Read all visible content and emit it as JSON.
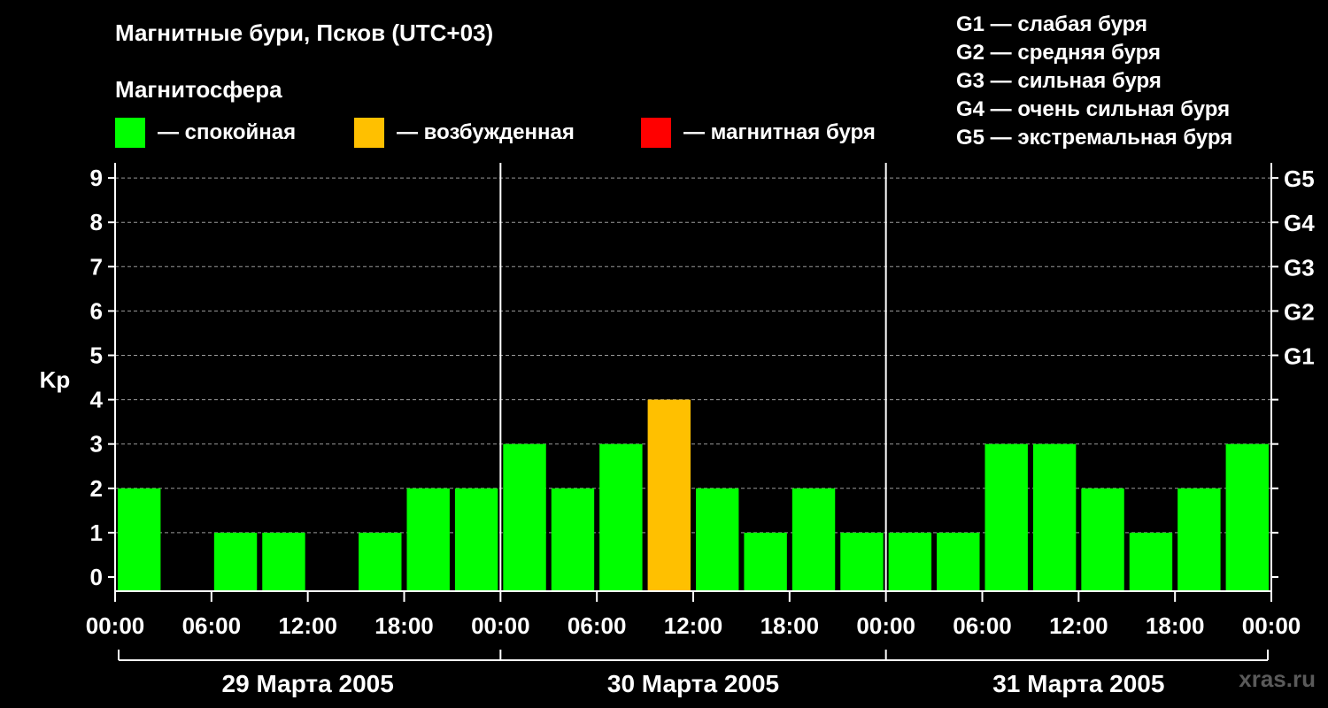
{
  "header": {
    "title": "Магнитные бури, Псков (UTC+03)",
    "subtitle": "Магнитосфера"
  },
  "legend": [
    {
      "label": "— спокойная",
      "color": "#00ff00"
    },
    {
      "label": "— возбужденная",
      "color": "#ffc000"
    },
    {
      "label": "— магнитная буря",
      "color": "#ff0000"
    }
  ],
  "gscale": [
    "G1 — слабая буря",
    "G2 — средняя буря",
    "G3 — сильная буря",
    "G4 — очень сильная буря",
    "G5 — экстремальная буря"
  ],
  "watermark": "xras.ru",
  "chart_data": {
    "type": "bar",
    "title": "Магнитные бури, Псков (UTC+03)",
    "ylabel": "Kp",
    "ylim": [
      0,
      9
    ],
    "yticks": [
      0,
      1,
      2,
      3,
      4,
      5,
      6,
      7,
      8,
      9
    ],
    "right_ticks": [
      {
        "value": 5,
        "label": "G1"
      },
      {
        "value": 6,
        "label": "G2"
      },
      {
        "value": 7,
        "label": "G3"
      },
      {
        "value": 8,
        "label": "G4"
      },
      {
        "value": 9,
        "label": "G5"
      }
    ],
    "grid": true,
    "x_tick_labels": [
      "00:00",
      "06:00",
      "12:00",
      "18:00",
      "00:00",
      "06:00",
      "12:00",
      "18:00",
      "00:00",
      "06:00",
      "12:00",
      "18:00",
      "00:00"
    ],
    "days": [
      "29 Марта 2005",
      "30 Марта 2005",
      "31 Марта 2005"
    ],
    "interval_hours": 3,
    "values": [
      2,
      0,
      1,
      1,
      0,
      1,
      2,
      2,
      3,
      2,
      3,
      4,
      2,
      1,
      2,
      1,
      1,
      1,
      3,
      3,
      2,
      1,
      2,
      3
    ],
    "colors": {
      "quiet": "#00ff00",
      "disturbed": "#ffc000",
      "storm": "#ff0000"
    }
  }
}
